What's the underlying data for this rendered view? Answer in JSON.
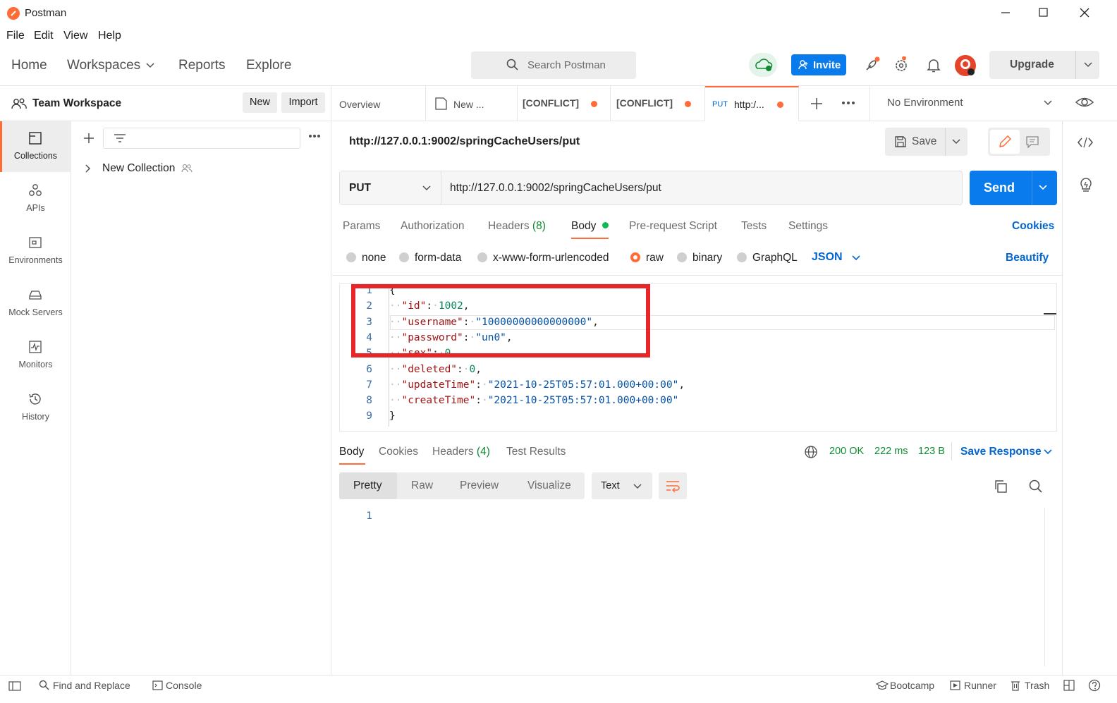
{
  "window": {
    "title": "Postman"
  },
  "menu": [
    "File",
    "Edit",
    "View",
    "Help"
  ],
  "header": {
    "nav": [
      "Home",
      "Workspaces",
      "Reports",
      "Explore"
    ],
    "search_placeholder": "Search Postman",
    "invite_label": "Invite",
    "upgrade_label": "Upgrade"
  },
  "workspace": {
    "name": "Team Workspace",
    "new_label": "New",
    "import_label": "Import"
  },
  "rail": [
    {
      "label": "Collections"
    },
    {
      "label": "APIs"
    },
    {
      "label": "Environments"
    },
    {
      "label": "Mock Servers"
    },
    {
      "label": "Monitors"
    },
    {
      "label": "History"
    }
  ],
  "collections": [
    {
      "name": "New Collection"
    }
  ],
  "tabs": [
    {
      "label": "Overview"
    },
    {
      "label": "New ..."
    },
    {
      "label": "[CONFLICT]"
    },
    {
      "label": "[CONFLICT]"
    },
    {
      "method": "PUT",
      "label": "http:/..."
    }
  ],
  "environment": "No Environment",
  "request": {
    "title": "http://127.0.0.1:9002/springCacheUsers/put",
    "save_label": "Save",
    "method": "PUT",
    "url": "http://127.0.0.1:9002/springCacheUsers/put",
    "send_label": "Send",
    "tabs": {
      "params": "Params",
      "authorization": "Authorization",
      "headers": "Headers",
      "headers_count": "(8)",
      "body": "Body",
      "prerequest": "Pre-request Script",
      "tests": "Tests",
      "settings": "Settings",
      "cookies": "Cookies"
    },
    "body_modes": [
      "none",
      "form-data",
      "x-www-form-urlencoded",
      "raw",
      "binary",
      "GraphQL"
    ],
    "body_format": "JSON",
    "beautify_label": "Beautify",
    "code": [
      {
        "n": "1",
        "text": "{"
      },
      {
        "n": "2",
        "key": "\"id\"",
        "val": "1002",
        "type": "num",
        "comma": ","
      },
      {
        "n": "3",
        "key": "\"username\"",
        "val": "\"10000000000000000\"",
        "type": "str",
        "comma": ","
      },
      {
        "n": "4",
        "key": "\"password\"",
        "val": "\"un0\"",
        "type": "str",
        "comma": ","
      },
      {
        "n": "5",
        "key": "\"sex\"",
        "val": "0",
        "type": "num",
        "comma": ","
      },
      {
        "n": "6",
        "key": "\"deleted\"",
        "val": "0",
        "type": "num",
        "comma": ","
      },
      {
        "n": "7",
        "key": "\"updateTime\"",
        "val": "\"2021-10-25T05:57:01.000+00:00\"",
        "type": "str",
        "comma": ","
      },
      {
        "n": "8",
        "key": "\"createTime\"",
        "val": "\"2021-10-25T05:57:01.000+00:00\"",
        "type": "str",
        "comma": ""
      },
      {
        "n": "9",
        "text": "}"
      }
    ]
  },
  "response": {
    "tabs": {
      "body": "Body",
      "cookies": "Cookies",
      "headers": "Headers",
      "headers_count": "(4)",
      "tests": "Test Results"
    },
    "status": "200 OK",
    "time": "222 ms",
    "size": "123 B",
    "save_response": "Save Response",
    "views": [
      "Pretty",
      "Raw",
      "Preview",
      "Visualize"
    ],
    "format": "Text",
    "line1": "1"
  },
  "statusbar": {
    "find_replace": "Find and Replace",
    "console": "Console",
    "bootcamp": "Bootcamp",
    "runner": "Runner",
    "trash": "Trash"
  },
  "colors": {
    "accent": "#ff6c37",
    "send_blue": "#097bed",
    "link_blue": "#0265d2",
    "status_green": "#0f8a32",
    "highlight_red": "#e8262a"
  }
}
